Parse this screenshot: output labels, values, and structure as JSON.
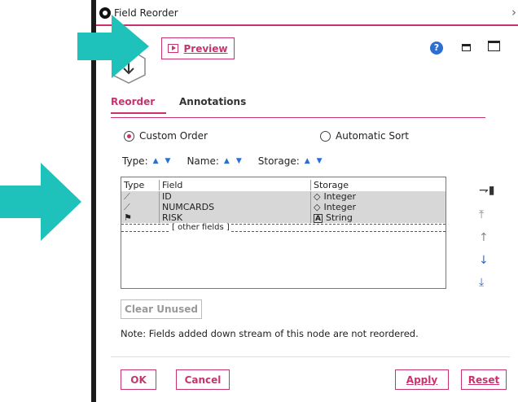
{
  "window": {
    "title": "Field Reorder"
  },
  "toolbar": {
    "preview_label": "Preview"
  },
  "tabs": [
    {
      "label": "Reorder",
      "active": true
    },
    {
      "label": "Annotations",
      "active": false
    }
  ],
  "ordering": {
    "custom_label": "Custom Order",
    "auto_label": "Automatic Sort",
    "selected": "Custom Order"
  },
  "sortbar": {
    "type_label": "Type:",
    "name_label": "Name:",
    "storage_label": "Storage:"
  },
  "table": {
    "columns": [
      "Type",
      "Field",
      "Storage"
    ],
    "rows": [
      {
        "type_icon": "ruler-icon",
        "field": "ID",
        "storage": "Integer",
        "storage_icon": "diamond-icon"
      },
      {
        "type_icon": "ruler-icon",
        "field": "NUMCARDS",
        "storage": "Integer",
        "storage_icon": "diamond-icon"
      },
      {
        "type_icon": "flag-icon",
        "field": "RISK",
        "storage": "String",
        "storage_icon": "string-icon"
      }
    ],
    "other_fields_label": "[ other fields ]"
  },
  "clear_unused_label": "Clear Unused",
  "note": "Note: Fields added down stream of this node are not reordered.",
  "buttons": {
    "ok": "OK",
    "cancel": "Cancel",
    "apply": "Apply",
    "reset": "Reset"
  },
  "colors": {
    "accent": "#c8336e",
    "overlay_arrow": "#1fc1bb",
    "link_blue": "#2c6fd1"
  }
}
